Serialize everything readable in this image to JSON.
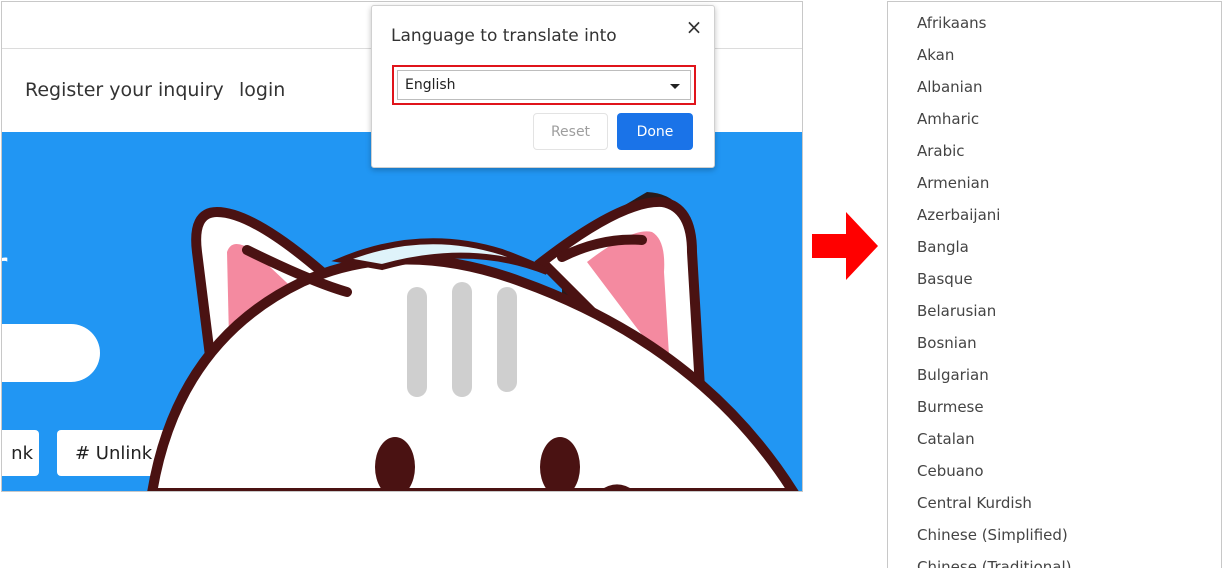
{
  "nav": {
    "register_label": "Register your inquiry",
    "login_label": "login"
  },
  "hero": {
    "partial_letter": "r",
    "link_button_partial": "nk",
    "unlink_button": "# Unlink account",
    "background_color": "#2196f3"
  },
  "popup": {
    "title": "Language to translate into",
    "close_icon": "×",
    "selected_language": "English",
    "reset_label": "Reset",
    "done_label": "Done",
    "highlight_color": "#e0141b",
    "done_color": "#1a73e8"
  },
  "arrow": {
    "color": "#ff0000",
    "icon": "right-arrow-icon"
  },
  "language_list": {
    "items": [
      "Afrikaans",
      "Akan",
      "Albanian",
      "Amharic",
      "Arabic",
      "Armenian",
      "Azerbaijani",
      "Bangla",
      "Basque",
      "Belarusian",
      "Bosnian",
      "Bulgarian",
      "Burmese",
      "Catalan",
      "Cebuano",
      "Central Kurdish",
      "Chinese (Simplified)",
      "Chinese (Traditional)"
    ]
  }
}
